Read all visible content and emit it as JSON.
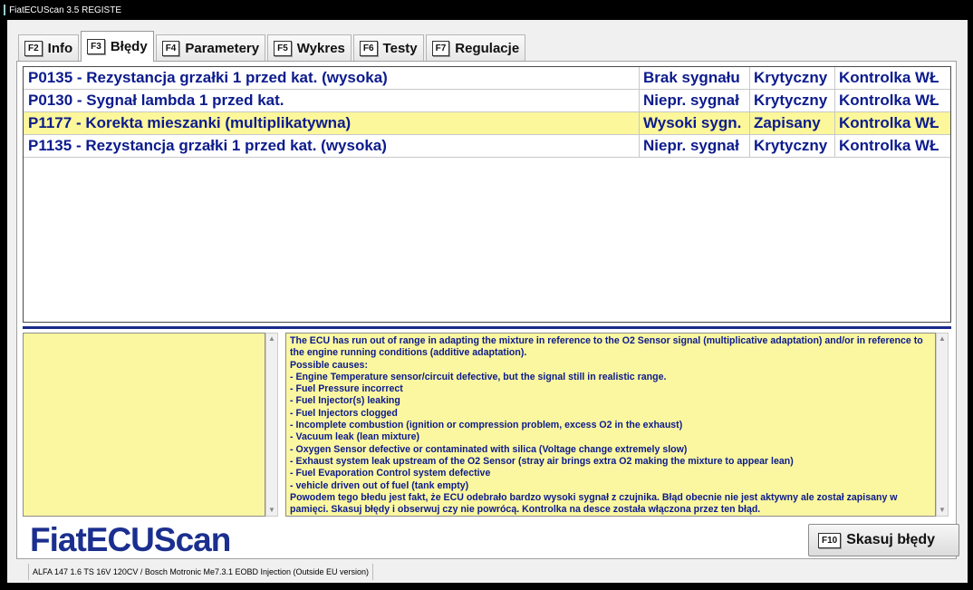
{
  "titlebar": {
    "title": "FiatECUScan 3.5 REGISTE"
  },
  "tabs": [
    {
      "key": "F2",
      "label": "Info",
      "active": false
    },
    {
      "key": "F3",
      "label": "Błędy",
      "active": true
    },
    {
      "key": "F4",
      "label": "Parametery",
      "active": false
    },
    {
      "key": "F5",
      "label": "Wykres",
      "active": false
    },
    {
      "key": "F6",
      "label": "Testy",
      "active": false
    },
    {
      "key": "F7",
      "label": "Regulacje",
      "active": false
    }
  ],
  "faults": [
    {
      "description": "P0135 - Rezystancja grzałki 1 przed kat. (wysoka)",
      "signal": "Brak sygnału",
      "status": "Krytyczny",
      "lamp": "Kontrolka WŁ",
      "selected": false
    },
    {
      "description": "P0130 - Sygnał lambda 1 przed kat.",
      "signal": "Niepr. sygnał",
      "status": "Krytyczny",
      "lamp": "Kontrolka WŁ",
      "selected": false
    },
    {
      "description": "P1177 - Korekta mieszanki (multiplikatywna)",
      "signal": "Wysoki sygn.",
      "status": "Zapisany",
      "lamp": "Kontrolka WŁ",
      "selected": true
    },
    {
      "description": "P1135 - Rezystancja grzałki 1 przed kat. (wysoka)",
      "signal": "Niepr. sygnał",
      "status": "Krytyczny",
      "lamp": "Kontrolka WŁ",
      "selected": false
    }
  ],
  "info_text": [
    "The ECU has run out of range in adapting the mixture in reference to the O2 Sensor signal (multiplicative adaptation) and/or in reference to the engine running conditions (additive adaptation).",
    "Possible causes:",
    "- Engine Temperature sensor/circuit defective, but the signal still in realistic range.",
    "- Fuel Pressure incorrect",
    "- Fuel Injector(s) leaking",
    "- Fuel Injectors clogged",
    "- Incomplete combustion (ignition or compression problem, excess O2 in the exhaust)",
    "- Vacuum leak (lean mixture)",
    "- Oxygen Sensor defective or contaminated with silica (Voltage change extremely slow)",
    "- Exhaust system leak upstream of the O2 Sensor (stray air brings extra O2 making the mixture to appear lean)",
    "- Fuel Evaporation Control system defective",
    "- vehicle driven out of fuel (tank empty)",
    "Powodem tego błedu jest fakt, że ECU odebrało bardzo wysoki sygnał z czujnika. Błąd obecnie nie jest aktywny ale został zapisany w pamięci. Skasuj błędy i obserwuj czy nie powrócą. Kontrolka na desce została włączona przez ten błąd."
  ],
  "logo": "FiatECUScan",
  "clear_button": {
    "key": "F10",
    "label": "Skasuj błędy"
  },
  "statusbar": {
    "vehicle": "ALFA 147 1.6 TS 16V 120CV / Bosch Motronic Me7.3.1 EOBD Injection (Outside EU version)"
  },
  "colors": {
    "highlight": "#fbf79a",
    "text_blue": "#0c1b8c",
    "logo_blue": "#1a2f8f"
  }
}
